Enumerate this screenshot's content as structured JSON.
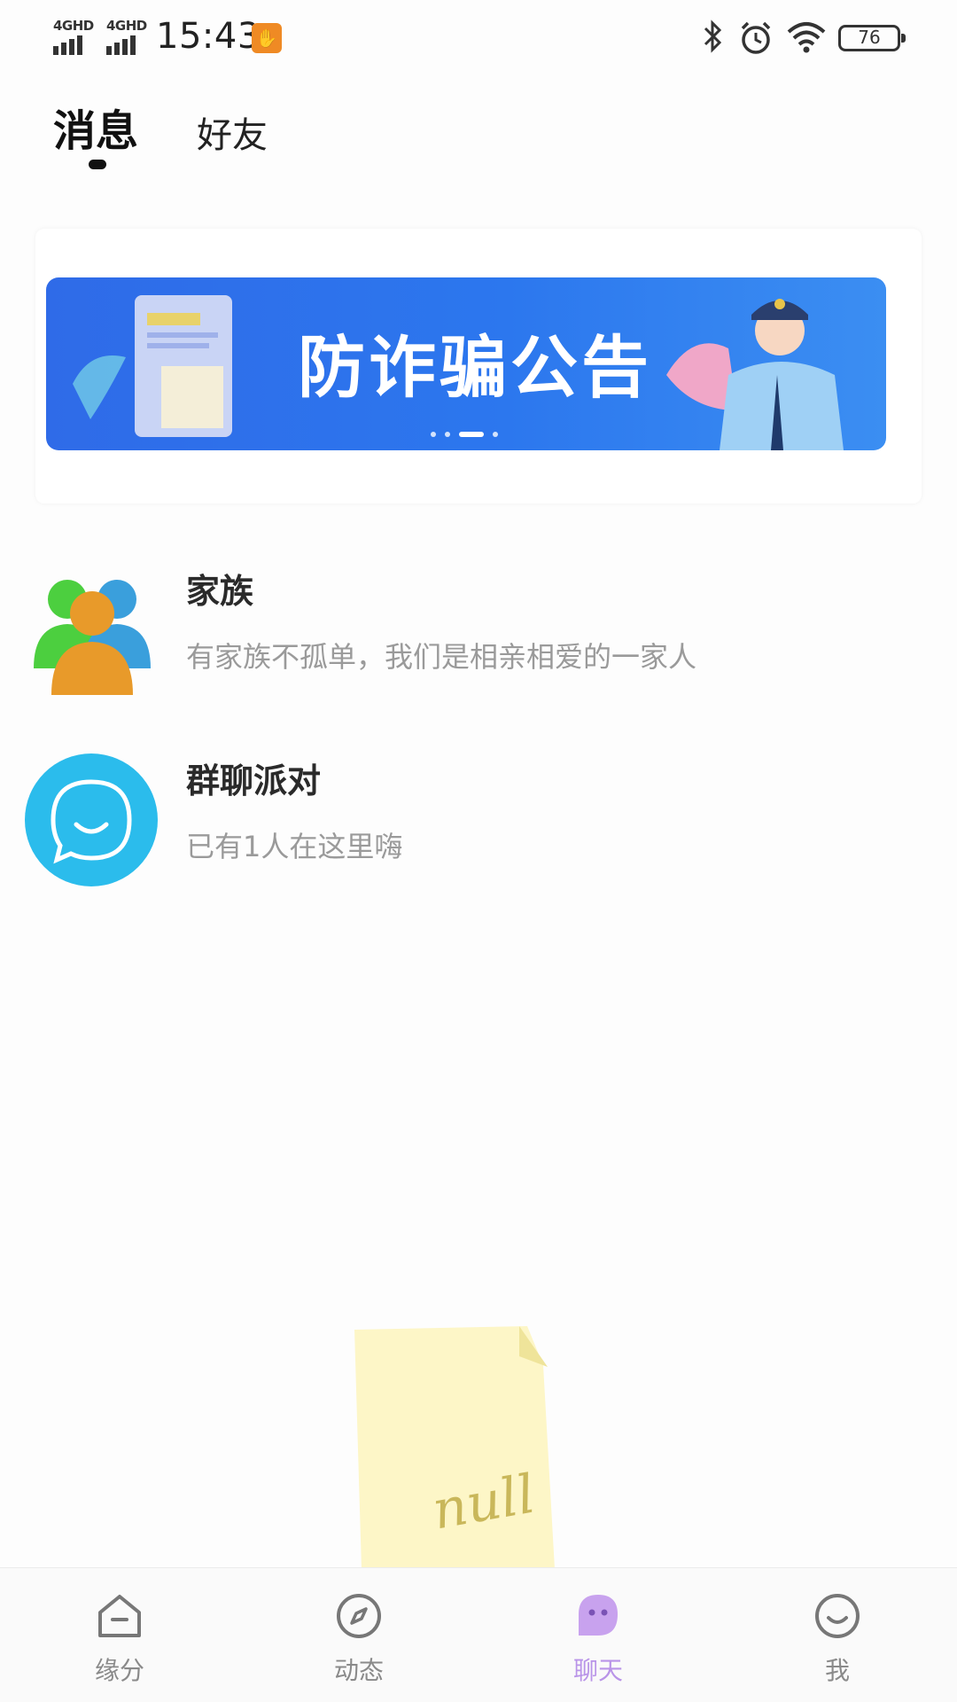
{
  "status_bar": {
    "network_1": "4GHD",
    "network_2": "4GHD",
    "time": "15:43",
    "battery": "76"
  },
  "tabs": {
    "active_label": "消息",
    "inactive_label": "好友"
  },
  "banner": {
    "title": "防诈骗公告",
    "slides_total": 4,
    "slide_active_index": 3
  },
  "list": [
    {
      "title": "家族",
      "subtitle": "有家族不孤单，我们是相亲相爱的一家人",
      "icon": "family-group-icon"
    },
    {
      "title": "群聊派对",
      "subtitle": "已有1人在这里嗨",
      "icon": "chat-bubble-icon"
    }
  ],
  "empty_state": {
    "text": "null"
  },
  "bottom_nav": {
    "items": [
      {
        "label": "缘分",
        "icon": "home-icon"
      },
      {
        "label": "动态",
        "icon": "compass-icon"
      },
      {
        "label": "聊天",
        "icon": "chat-face-icon"
      },
      {
        "label": "我",
        "icon": "smile-icon"
      }
    ],
    "active_index": 2
  },
  "colors": {
    "accent": "#b994e8",
    "banner_blue": "#2f6be8",
    "chat_blue": "#2bbcec",
    "family_green": "#4ccf3f",
    "family_orange": "#e89a2a",
    "family_blue": "#3a9fdc"
  }
}
